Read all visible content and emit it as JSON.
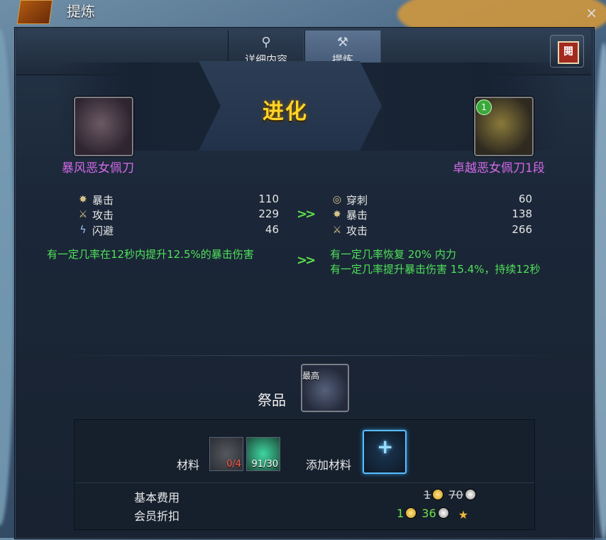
{
  "window": {
    "title": "提炼"
  },
  "tabs": [
    {
      "label": "详细内容",
      "icon": "magnifier-icon"
    },
    {
      "label": "提炼",
      "icon": "anvil-icon"
    }
  ],
  "book_button": {
    "icon": "guide-book-icon",
    "glyph": "閱"
  },
  "evolution": {
    "label": "进化",
    "source": {
      "name": "暴风恶女佩刀"
    },
    "target": {
      "name": "卓越恶女佩刀1段",
      "badge": "1"
    }
  },
  "stats": {
    "before": [
      {
        "name": "暴击",
        "value": "110",
        "icon": "critical-icon"
      },
      {
        "name": "攻击",
        "value": "229",
        "icon": "crossed-swords-icon"
      },
      {
        "name": "闪避",
        "value": "46",
        "icon": "lightning-icon"
      }
    ],
    "after": [
      {
        "name": "穿刺",
        "value": "60",
        "icon": "pierce-icon"
      },
      {
        "name": "暴击",
        "value": "138",
        "icon": "critical-icon"
      },
      {
        "name": "攻击",
        "value": "266",
        "icon": "crossed-swords-icon"
      }
    ],
    "effect_before": "有一定几率在12秒内提升12.5%的暴击伤害",
    "effect_after_1": "有一定几率恢复 20% 内力",
    "effect_after_2": "有一定几率提升暴击伤害 15.4%，持续12秒"
  },
  "sacrifice": {
    "label": "祭品",
    "tag": "最高"
  },
  "materials": {
    "label": "材料",
    "slots": [
      {
        "count": "0/4",
        "color": "#ff5a4a"
      },
      {
        "count": "91/30",
        "color": "#ffffff"
      }
    ],
    "add_label": "添加材料"
  },
  "cost": {
    "base_label": "基本费用",
    "base_gold": "1",
    "base_silver": "70",
    "member_label": "会员折扣",
    "member_gold": "1",
    "member_silver": "36"
  }
}
